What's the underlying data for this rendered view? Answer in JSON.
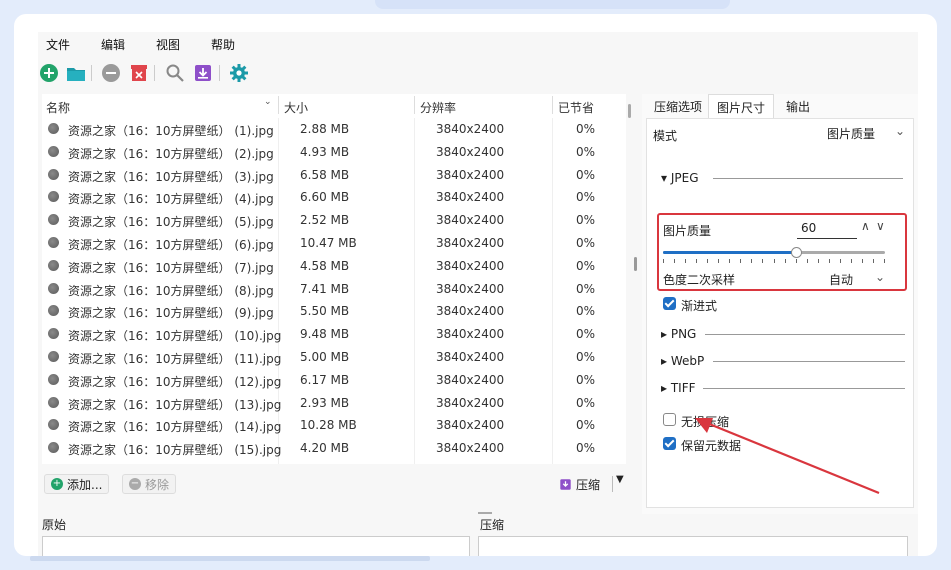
{
  "menu": {
    "file": "文件",
    "edit": "编辑",
    "view": "视图",
    "help": "帮助"
  },
  "toolbar": {
    "add_icon": "plus-circle-green",
    "folder_icon": "folder-teal",
    "remove_icon": "minus-circle-gray",
    "delete_icon": "trash-red",
    "search_icon": "magnifier-gray",
    "save_icon": "download-purple",
    "settings_icon": "gear-teal"
  },
  "file_list": {
    "columns": {
      "name": "名称",
      "size": "大小",
      "resolution": "分辨率",
      "saved": "已节省"
    },
    "rows": [
      {
        "name": "资源之家（16：10方屏壁纸） (1).jpg",
        "size": "2.88 MB",
        "res": "3840x2400",
        "saved": "0%"
      },
      {
        "name": "资源之家（16：10方屏壁纸） (2).jpg",
        "size": "4.93 MB",
        "res": "3840x2400",
        "saved": "0%"
      },
      {
        "name": "资源之家（16：10方屏壁纸） (3).jpg",
        "size": "6.58 MB",
        "res": "3840x2400",
        "saved": "0%"
      },
      {
        "name": "资源之家（16：10方屏壁纸） (4).jpg",
        "size": "6.60 MB",
        "res": "3840x2400",
        "saved": "0%"
      },
      {
        "name": "资源之家（16：10方屏壁纸） (5).jpg",
        "size": "2.52 MB",
        "res": "3840x2400",
        "saved": "0%"
      },
      {
        "name": "资源之家（16：10方屏壁纸） (6).jpg",
        "size": "10.47 MB",
        "res": "3840x2400",
        "saved": "0%"
      },
      {
        "name": "资源之家（16：10方屏壁纸） (7).jpg",
        "size": "4.58 MB",
        "res": "3840x2400",
        "saved": "0%"
      },
      {
        "name": "资源之家（16：10方屏壁纸） (8).jpg",
        "size": "7.41 MB",
        "res": "3840x2400",
        "saved": "0%"
      },
      {
        "name": "资源之家（16：10方屏壁纸） (9).jpg",
        "size": "5.50 MB",
        "res": "3840x2400",
        "saved": "0%"
      },
      {
        "name": "资源之家（16：10方屏壁纸） (10).jpg",
        "size": "9.48 MB",
        "res": "3840x2400",
        "saved": "0%"
      },
      {
        "name": "资源之家（16：10方屏壁纸） (11).jpg",
        "size": "5.00 MB",
        "res": "3840x2400",
        "saved": "0%"
      },
      {
        "name": "资源之家（16：10方屏壁纸） (12).jpg",
        "size": "6.17 MB",
        "res": "3840x2400",
        "saved": "0%"
      },
      {
        "name": "资源之家（16：10方屏壁纸） (13).jpg",
        "size": "2.93 MB",
        "res": "3840x2400",
        "saved": "0%"
      },
      {
        "name": "资源之家（16：10方屏壁纸） (14).jpg",
        "size": "10.28 MB",
        "res": "3840x2400",
        "saved": "0%"
      },
      {
        "name": "资源之家（16：10方屏壁纸） (15).jpg",
        "size": "4.20 MB",
        "res": "3840x2400",
        "saved": "0%"
      }
    ]
  },
  "bottom_bar": {
    "add_label": "添加...",
    "remove_label": "移除",
    "compress_label": "压缩"
  },
  "right_panel": {
    "tabs": {
      "compress_options": "压缩选项",
      "image_size": "图片尺寸",
      "output": "输出"
    },
    "mode_label": "模式",
    "mode_value": "图片质量",
    "jpeg_section": "JPEG",
    "quality_label": "图片质量",
    "quality_value": "60",
    "quality_fraction": 0.6,
    "chroma_label": "色度二次采样",
    "chroma_value": "自动",
    "progressive_label": "渐进式",
    "png_section": "PNG",
    "webp_section": "WebP",
    "tiff_section": "TIFF",
    "lossless_label": "无损压缩",
    "keep_metadata_label": "保留元数据",
    "highlight_color": "#d9363e",
    "accent_color": "#1f6fc5"
  },
  "lower": {
    "original_label": "原始",
    "compressed_label": "压缩"
  }
}
